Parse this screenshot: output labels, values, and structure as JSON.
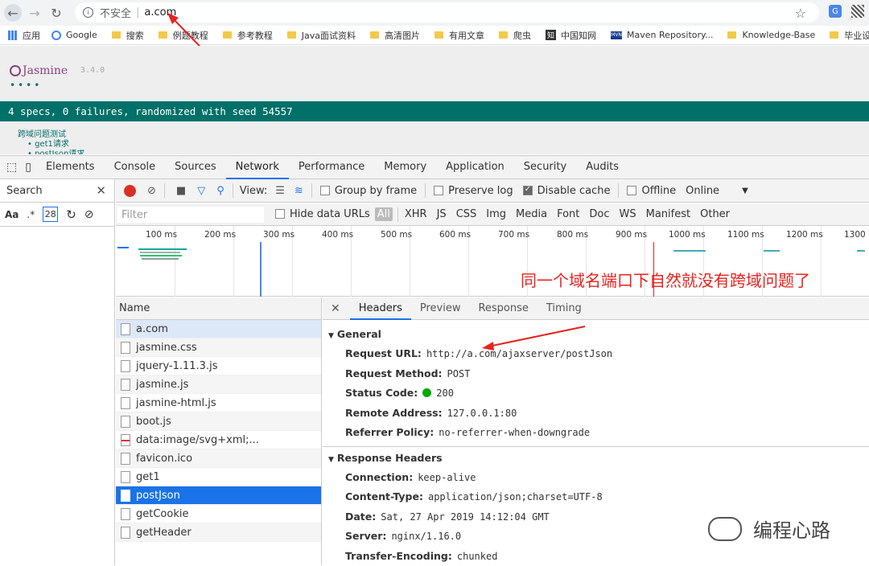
{
  "browser": {
    "security_label": "不安全",
    "separator": "|",
    "url": "a.com",
    "bookmarks": [
      "应用",
      "Google",
      "搜索",
      "例题教程",
      "参考教程",
      "Java面试资料",
      "高清图片",
      "有用文章",
      "爬虫",
      "中国知网",
      "Maven Repository...",
      "Knowledge-Base",
      "毕业设计"
    ]
  },
  "jasmine": {
    "logo_text": "Jasmine",
    "version": "3.4.0",
    "dots": "••••",
    "banner": "4 specs, 0 failures, randomized with seed 54557",
    "suite_name": "跨域问题测试",
    "spec_1": "• get1请求",
    "spec_2": "• postJson请求"
  },
  "devtools": {
    "tabs": [
      "Elements",
      "Console",
      "Sources",
      "Network",
      "Performance",
      "Memory",
      "Application",
      "Security",
      "Audits"
    ],
    "active_tab": "Network",
    "search": {
      "label": "Search",
      "case_label": "Aa",
      "regex_label": ".*",
      "count": "28"
    },
    "toolbar": {
      "view_label": "View:",
      "group_by_frame": "Group by frame",
      "preserve_log": "Preserve log",
      "disable_cache": "Disable cache",
      "offline": "Offline",
      "online": "Online"
    },
    "filter": {
      "placeholder": "Filter",
      "hide_data_urls": "Hide data URLs",
      "types": [
        "All",
        "XHR",
        "JS",
        "CSS",
        "Img",
        "Media",
        "Font",
        "Doc",
        "WS",
        "Manifest",
        "Other"
      ]
    },
    "timeline_ticks": [
      "100 ms",
      "200 ms",
      "300 ms",
      "400 ms",
      "500 ms",
      "600 ms",
      "700 ms",
      "800 ms",
      "900 ms",
      "1000 ms",
      "1100 ms",
      "1200 ms",
      "1300 ms"
    ],
    "annotation": "同一个域名端口下自然就没有跨域问题了",
    "name_header": "Name",
    "requests": [
      "a.com",
      "jasmine.css",
      "jquery-1.11.3.js",
      "jasmine.js",
      "jasmine-html.js",
      "boot.js",
      "data:image/svg+xml;...",
      "favicon.ico",
      "get1",
      "postJson",
      "getCookie",
      "getHeader"
    ],
    "selected_request": "postJson",
    "detail_tabs": [
      "Headers",
      "Preview",
      "Response",
      "Timing"
    ],
    "general": {
      "title": "General",
      "request_url_k": "Request URL:",
      "request_url_v": "http://a.com/ajaxserver/postJson",
      "method_k": "Request Method:",
      "method_v": "POST",
      "status_k": "Status Code:",
      "status_v": "200",
      "remote_k": "Remote Address:",
      "remote_v": "127.0.0.1:80",
      "referrer_k": "Referrer Policy:",
      "referrer_v": "no-referrer-when-downgrade"
    },
    "response_headers": {
      "title": "Response Headers",
      "connection_k": "Connection:",
      "connection_v": "keep-alive",
      "ctype_k": "Content-Type:",
      "ctype_v": "application/json;charset=UTF-8",
      "date_k": "Date:",
      "date_v": "Sat, 27 Apr 2019 14:12:04 GMT",
      "server_k": "Server:",
      "server_v": "nginx/1.16.0",
      "te_k": "Transfer-Encoding:",
      "te_v": "chunked"
    }
  },
  "watermark": "编程心路",
  "colors": {
    "accent": "#1a73e8",
    "jasmine_green": "#007069",
    "annotation_red": "#e6231f"
  }
}
